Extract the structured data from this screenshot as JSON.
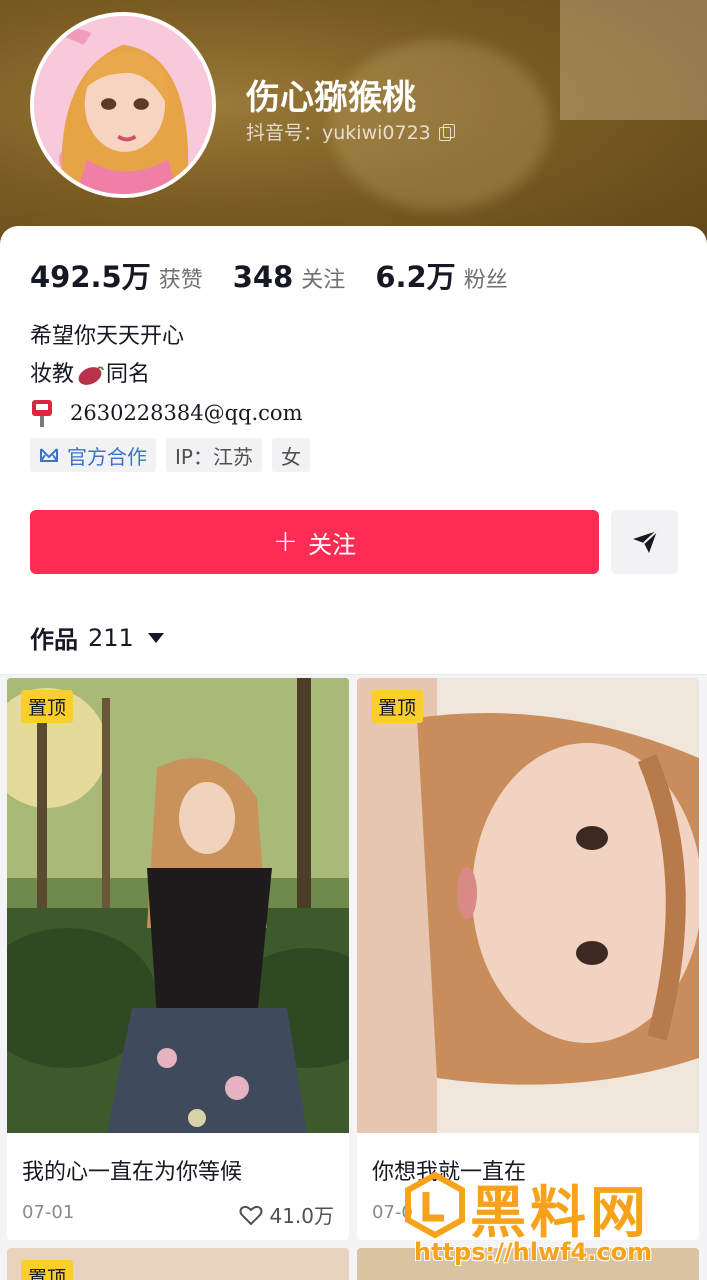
{
  "profile": {
    "nickname": "伤心猕猴桃",
    "douyin_id_label": "抖音号：yukiwi0723"
  },
  "stats": [
    {
      "value": "492.5万",
      "label": "获赞"
    },
    {
      "value": "348",
      "label": "关注"
    },
    {
      "value": "6.2万",
      "label": "粉丝"
    }
  ],
  "bio": {
    "line1": "希望你天天开心",
    "line2_prefix": "妆教",
    "line2_suffix": "同名",
    "email": "2630228384@qq.com"
  },
  "tags": {
    "official": "官方合作",
    "ip": "IP：江苏",
    "gender": "女"
  },
  "actions": {
    "follow_label": "关注",
    "plus_symbol": "+"
  },
  "works": {
    "label": "作品",
    "count": "211"
  },
  "videos": [
    {
      "pinned": "置顶",
      "caption": "我的心一直在为你等候",
      "date": "07-01",
      "likes": "41.0万"
    },
    {
      "pinned": "置顶",
      "caption": "你想我就一直在",
      "date": "07-0",
      "likes": ""
    }
  ],
  "next_row": {
    "pinned": "置顶"
  },
  "watermark": {
    "brand": "黑料网",
    "url": "https://hlwf4.com"
  },
  "colors": {
    "accent": "#fe2c55",
    "pinned_badge": "#facf2b",
    "official_tag": "#3a73c9",
    "watermark": "#f8a21a"
  }
}
